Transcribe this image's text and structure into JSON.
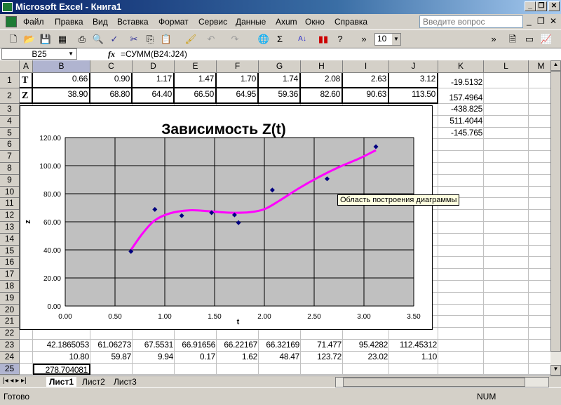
{
  "window": {
    "title": "Microsoft Excel - Книга1"
  },
  "menu": [
    "Файл",
    "Правка",
    "Вид",
    "Вставка",
    "Формат",
    "Сервис",
    "Данные",
    "Axum",
    "Окно",
    "Справка"
  ],
  "ask": {
    "placeholder": "Введите вопрос"
  },
  "toolbar": {
    "font_size": "10"
  },
  "formula": {
    "name_box": "B25",
    "fx": "fx",
    "formula": "=СУММ(B24:J24)"
  },
  "columns": [
    "A",
    "B",
    "C",
    "D",
    "E",
    "F",
    "G",
    "H",
    "I",
    "J",
    "K",
    "L",
    "M"
  ],
  "rows": [
    "1",
    "2",
    "3",
    "4",
    "5",
    "6",
    "7",
    "8",
    "9",
    "10",
    "11",
    "12",
    "13",
    "14",
    "15",
    "16",
    "17",
    "18",
    "19",
    "20",
    "21",
    "22",
    "23",
    "24",
    "25"
  ],
  "cells": {
    "r1": {
      "label": "T",
      "values": [
        "0.66",
        "0.90",
        "1.17",
        "1.47",
        "1.70",
        "1.74",
        "2.08",
        "2.63",
        "3.12"
      ],
      "k": "-19.5132"
    },
    "r2": {
      "label": "Z",
      "values": [
        "38.90",
        "68.80",
        "64.40",
        "66.50",
        "64.95",
        "59.36",
        "82.60",
        "90.63",
        "113.50"
      ],
      "k": "157.4964"
    },
    "k3": "-438.825",
    "k4": "511.4044",
    "k5": "-145.765",
    "r23": [
      "42.1865053",
      "61.06273",
      "67.5531",
      "66.91656",
      "66.22167",
      "66.32169",
      "71.477",
      "95.4282",
      "112.45312"
    ],
    "r24": [
      "10.80",
      "59.87",
      "9.94",
      "0.17",
      "1.62",
      "48.47",
      "123.72",
      "23.02",
      "1.10"
    ],
    "b25": "278.704081"
  },
  "chart_data": {
    "type": "scatter",
    "title": "Зависимость Z(t)",
    "xlabel": "t",
    "ylabel": "z",
    "xlim": [
      0,
      3.5
    ],
    "ylim": [
      0,
      120
    ],
    "xticks": [
      "0.00",
      "0.50",
      "1.00",
      "1.50",
      "2.00",
      "2.50",
      "3.00",
      "3.50"
    ],
    "yticks": [
      "0.00",
      "20.00",
      "40.00",
      "60.00",
      "80.00",
      "100.00",
      "120.00"
    ],
    "grid": true,
    "x": [
      0.66,
      0.9,
      1.17,
      1.47,
      1.7,
      1.74,
      2.08,
      2.63,
      3.12
    ],
    "y": [
      38.9,
      68.8,
      64.4,
      66.5,
      64.95,
      59.36,
      82.6,
      90.63,
      113.5
    ],
    "trend_points": [
      [
        0.66,
        40
      ],
      [
        0.78,
        52
      ],
      [
        0.9,
        61
      ],
      [
        1.05,
        66
      ],
      [
        1.25,
        68.2
      ],
      [
        1.45,
        67.5
      ],
      [
        1.65,
        66.5
      ],
      [
        1.85,
        66.8
      ],
      [
        2.0,
        69
      ],
      [
        2.15,
        75
      ],
      [
        2.35,
        84
      ],
      [
        2.55,
        92
      ],
      [
        2.75,
        99
      ],
      [
        2.95,
        105
      ],
      [
        3.12,
        111
      ]
    ],
    "marker_color": "#000080",
    "trend_color": "#ff00ff",
    "plot_bg": "#c0c0c0"
  },
  "tooltip": "Область построения диаграммы",
  "sheets": [
    "Лист1",
    "Лист2",
    "Лист3"
  ],
  "status": {
    "ready": "Готово",
    "num": "NUM"
  }
}
